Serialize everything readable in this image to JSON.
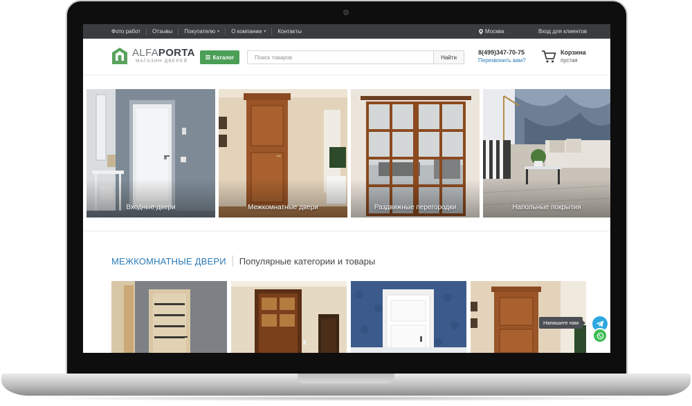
{
  "topbar": {
    "nav": [
      {
        "label": "Фото работ",
        "dropdown": false
      },
      {
        "label": "Отзывы",
        "dropdown": false
      },
      {
        "label": "Покупателю",
        "dropdown": true
      },
      {
        "label": "О компании",
        "dropdown": true
      },
      {
        "label": "Контакты",
        "dropdown": false
      }
    ],
    "city": "Москва",
    "login": "Вход для клиентов"
  },
  "header": {
    "logo_light": "ALFA",
    "logo_bold": "PORTA",
    "logo_sub": "МАГАЗИН ДВЕРЕЙ",
    "catalog_label": "Каталог",
    "search_placeholder": "Поиск товаров",
    "search_button": "Найти",
    "phone": "8(499)347-70-75",
    "callback": "Перезвонить вам?",
    "cart_title": "Корзина",
    "cart_status": "пустая"
  },
  "categories": [
    {
      "label": "Входные двери"
    },
    {
      "label": "Межкомнатные двери"
    },
    {
      "label": "Раздвижные перегородки"
    },
    {
      "label": "Напольные покрытия"
    }
  ],
  "section": {
    "title": "МЕЖКОМНАТНЫЕ ДВЕРИ",
    "subtitle": "Популярные категории и товары"
  },
  "chat": {
    "tooltip": "Напишите нам"
  },
  "colors": {
    "accent_green": "#4a9e56",
    "link_blue": "#2a7ab5",
    "topbar": "#3a3d40"
  }
}
